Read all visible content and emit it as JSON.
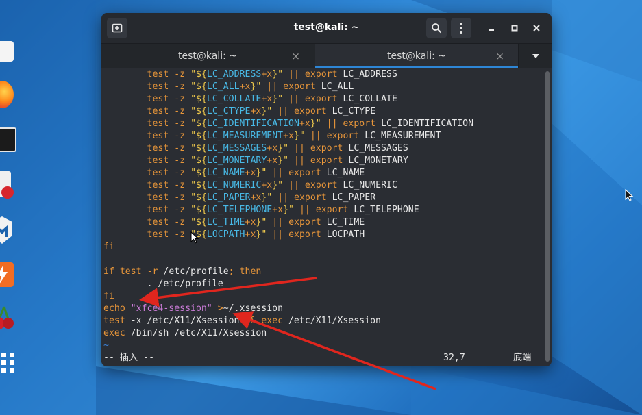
{
  "window": {
    "title": "test@kali: ~",
    "new_tab_icon": "new-tab-icon",
    "search_icon": "search-icon",
    "menu_icon": "kebab-menu-icon",
    "minimize_glyph": "–",
    "maximize_glyph": "■",
    "close_glyph": "✕"
  },
  "tabs": [
    {
      "label": "test@kali: ~",
      "close_glyph": "×",
      "active": false
    },
    {
      "label": "test@kali: ~",
      "close_glyph": "×",
      "active": true
    }
  ],
  "tab_dropdown_glyph": "▼",
  "dock": [
    {
      "name": "file-manager-icon"
    },
    {
      "name": "firefox-icon"
    },
    {
      "name": "terminal-icon"
    },
    {
      "name": "text-editor-icon"
    },
    {
      "name": "metasploit-icon"
    },
    {
      "name": "burpsuite-icon"
    },
    {
      "name": "cherrytree-icon"
    },
    {
      "name": "show-applications-icon"
    }
  ],
  "terminal": {
    "lines": [
      {
        "indent": "        ",
        "name": "LC_ADDRESS"
      },
      {
        "indent": "        ",
        "name": "LC_ALL"
      },
      {
        "indent": "        ",
        "name": "LC_COLLATE"
      },
      {
        "indent": "        ",
        "name": "LC_CTYPE"
      },
      {
        "indent": "        ",
        "name": "LC_IDENTIFICATION"
      },
      {
        "indent": "        ",
        "name": "LC_MEASUREMENT"
      },
      {
        "indent": "        ",
        "name": "LC_MESSAGES"
      },
      {
        "indent": "        ",
        "name": "LC_MONETARY"
      },
      {
        "indent": "        ",
        "name": "LC_NAME"
      },
      {
        "indent": "        ",
        "name": "LC_NUMERIC"
      },
      {
        "indent": "        ",
        "name": "LC_PAPER"
      },
      {
        "indent": "        ",
        "name": "LC_TELEPHONE"
      },
      {
        "indent": "        ",
        "name": "LC_TIME"
      },
      {
        "indent": "        ",
        "name": "LOCPATH"
      }
    ],
    "test_kw": "test",
    "flag_z": "-z",
    "export_kw": "export",
    "or_op": "||",
    "plus_x": "+x",
    "fi_1": "fi",
    "if_line": {
      "if": "if",
      "test": "test",
      "flag": "-r",
      "path": " /etc/profile",
      "semi": ";",
      "then": " then"
    },
    "source_line": "        . /etc/profile",
    "fi_2": "fi",
    "echo_line": {
      "cmd": "echo ",
      "str": "\"xfce4-session\"",
      "redir": " >",
      "target": "~/.xsession"
    },
    "test_line": {
      "cmd": "test",
      "rest": " -x /etc/X11/Xsession ",
      "and": "&&",
      "exec": " exec",
      "path": " /etc/X11/Xsession"
    },
    "exec_line": {
      "cmd": "exec",
      "rest": " /bin/sh /etc/X11/Xsession"
    },
    "tilde": "~",
    "status": {
      "mode": "-- 插入 --",
      "position": "32,7",
      "scroll": "底端"
    }
  },
  "colors": {
    "keyword": "#e6953a",
    "string": "#efc94c",
    "variable": "#48b9e6",
    "purple_string": "#c97bd6",
    "accent_tab": "#2e86d6",
    "annotation_arrow": "#e0261e"
  }
}
